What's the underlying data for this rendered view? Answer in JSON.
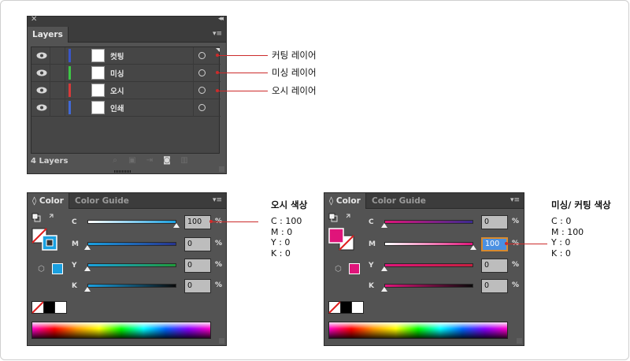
{
  "layers_panel": {
    "tab": "Layers",
    "layers": [
      {
        "name": "컷팅",
        "color": "#3a56c7"
      },
      {
        "name": "미싱",
        "color": "#3ec646"
      },
      {
        "name": "오시",
        "color": "#d63a3a"
      },
      {
        "name": "인쇄",
        "color": "#4169d6"
      }
    ],
    "footer": "4 Layers"
  },
  "layer_annotations": [
    "커팅 레이어",
    "미싱 레이어",
    "오시 레이어"
  ],
  "color_panel_left": {
    "tab_color": "Color",
    "tab_guide": "Color Guide",
    "channels": [
      {
        "label": "C",
        "value": "100"
      },
      {
        "label": "M",
        "value": "0"
      },
      {
        "label": "Y",
        "value": "0"
      },
      {
        "label": "K",
        "value": "0"
      }
    ],
    "pct": "%",
    "fill_color": "#1aa0e0"
  },
  "color_panel_right": {
    "tab_color": "Color",
    "tab_guide": "Color Guide",
    "channels": [
      {
        "label": "C",
        "value": "0"
      },
      {
        "label": "M",
        "value": "100"
      },
      {
        "label": "Y",
        "value": "0"
      },
      {
        "label": "K",
        "value": "0"
      }
    ],
    "pct": "%",
    "fill_color": "#e0147a"
  },
  "annotation_left": {
    "title": "오시 색상",
    "lines": [
      "C : 100",
      "M : 0",
      "Y : 0",
      "K : 0"
    ]
  },
  "annotation_right": {
    "title": "미싱/ 커팅 색상",
    "lines": [
      "C : 0",
      "M : 100",
      "Y : 0",
      "K : 0"
    ]
  }
}
